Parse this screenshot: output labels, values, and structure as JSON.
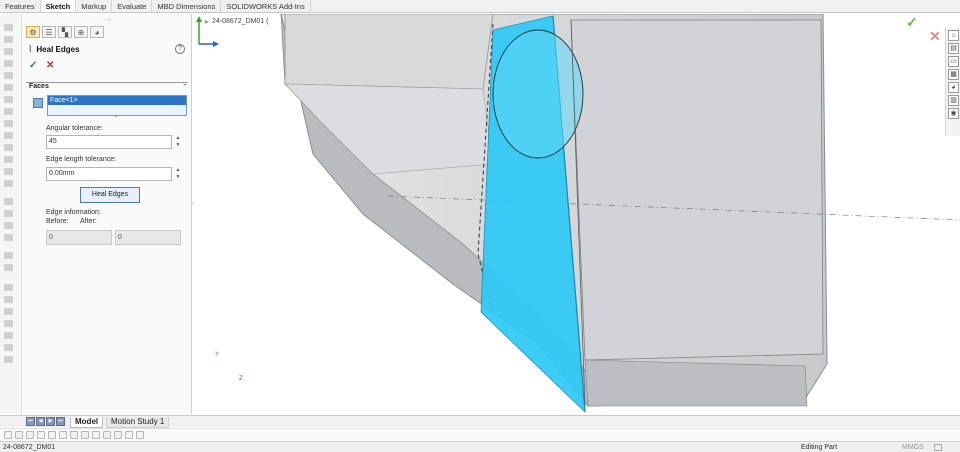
{
  "command_tabs": [
    "Features",
    "Sketch",
    "Markup",
    "Evaluate",
    "MBD Dimensions",
    "SOLIDWORKS Add-Ins"
  ],
  "active_tab": "Sketch",
  "property_manager": {
    "title": "Heal Edges",
    "help": "?",
    "ok_icon": "check-icon",
    "cancel_icon": "x-icon",
    "section_faces": "Faces",
    "faces_selection": [
      "Face<1>"
    ],
    "angular_tolerance_label": "Angular tolerance:",
    "angular_tolerance_value": "45",
    "edge_length_label": "Edge length tolerance:",
    "edge_length_value": "0.00mm",
    "heal_button": "Heal Edges",
    "edge_info_label": "Edge information:",
    "before_label": "Before:",
    "after_label": "After:",
    "before_value": "0",
    "after_value": "0"
  },
  "viewport": {
    "tree_crumb": "24-08672_DM01  (",
    "confirm_ok_icon": "check-icon",
    "confirm_cancel_icon": "x-icon",
    "triad_y": "Y",
    "triad_z": "Z",
    "accent_face": "#2cc9f5",
    "body_color": "#cfd1d4"
  },
  "bottom_tabs": [
    "Model",
    "Motion Study 1"
  ],
  "active_bottom_tab": "Model",
  "status_bar": {
    "document": "24-08672_DM01",
    "mode": "Editing Part",
    "units": "MMGS"
  }
}
